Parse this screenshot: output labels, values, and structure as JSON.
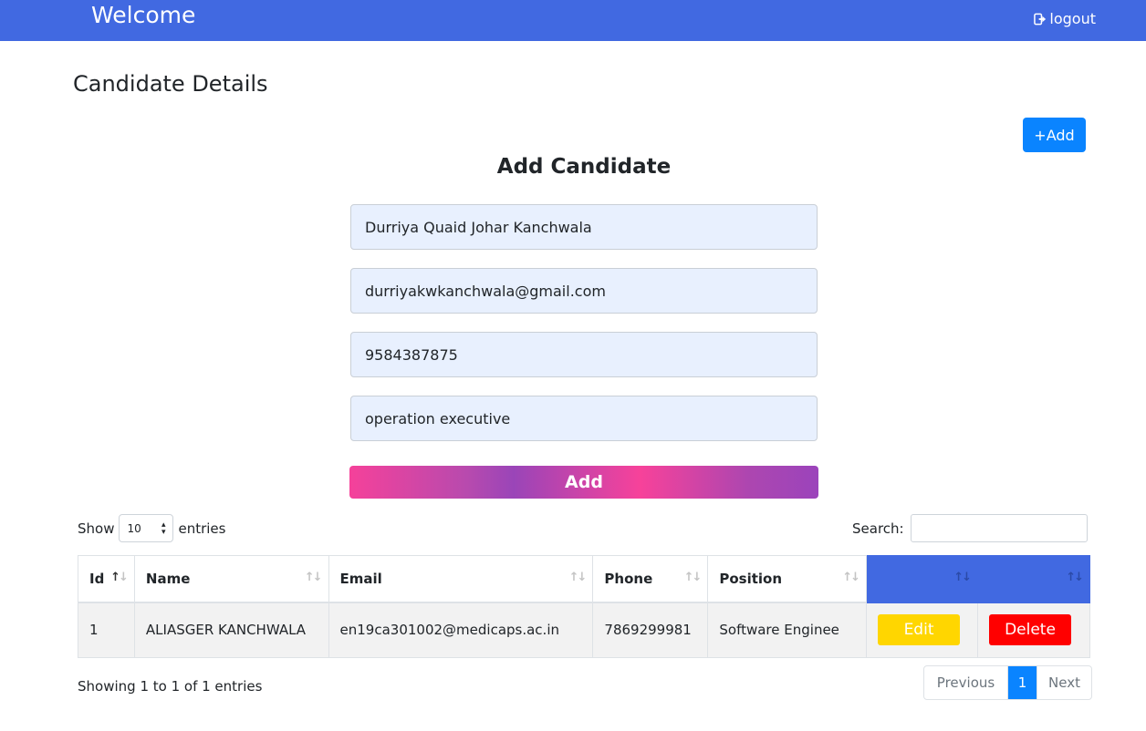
{
  "header": {
    "brand": "Welcome",
    "logout_label": "logout"
  },
  "page": {
    "title": "Candidate Details",
    "add_button": "+Add"
  },
  "form": {
    "title": "Add Candidate",
    "name_value": "Durriya Quaid Johar Kanchwala",
    "email_value": "durriyakwkanchwala@gmail.com",
    "phone_value": "9584387875",
    "position_value": "operation executive",
    "submit_label": "Add"
  },
  "table_controls": {
    "show_label": "Show",
    "entries_value": "10",
    "entries_label": "entries",
    "search_label": "Search:"
  },
  "table": {
    "headers": [
      "Id",
      "Name",
      "Email",
      "Phone",
      "Position",
      "",
      ""
    ],
    "rows": [
      {
        "id": "1",
        "name": "ALIASGER KANCHWALA",
        "email": "en19ca301002@medicaps.ac.in",
        "phone": "7869299981",
        "position": "Software Enginee",
        "edit_label": "Edit",
        "delete_label": "Delete"
      }
    ]
  },
  "footer": {
    "showing": "Showing 1 to 1 of 1 entries",
    "previous": "Previous",
    "page": "1",
    "next": "Next"
  },
  "colors": {
    "header_bg": "#4169e1",
    "primary": "#0a84ff",
    "edit": "#ffd600",
    "delete": "#ff0000"
  }
}
